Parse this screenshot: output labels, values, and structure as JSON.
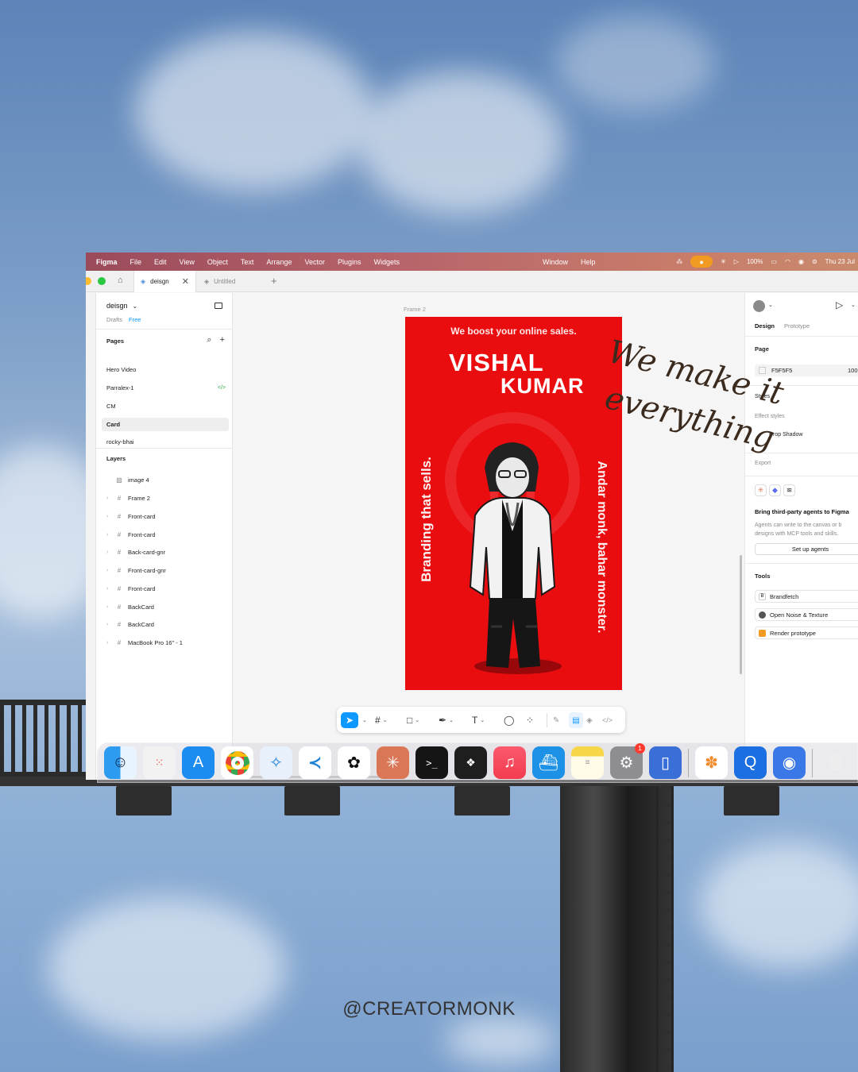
{
  "menubar": {
    "app": "Figma",
    "items": [
      "File",
      "Edit",
      "View",
      "Object",
      "Text",
      "Arrange",
      "Vector",
      "Plugins",
      "Widgets"
    ],
    "right_items": [
      "Window",
      "Help"
    ],
    "battery": "100%",
    "clock": "Thu 23 Jul"
  },
  "tabs": {
    "active": "deisgn",
    "inactive": "Untitled"
  },
  "file": {
    "name": "deisgn",
    "location": "Drafts",
    "plan": "Free"
  },
  "pages": {
    "title": "Pages",
    "items": [
      "Hero Video",
      "Parralex-1",
      "CM",
      "Card",
      "rocky-bhai"
    ],
    "selected": "Card"
  },
  "layers": {
    "title": "Layers",
    "items": [
      "image 4",
      "Frame 2",
      "Front-card",
      "Front-card",
      "Back-card-gnr",
      "Front-card-gnr",
      "Front-card",
      "BackCard",
      "BackCard",
      "MacBook Pro 16\" - 1"
    ]
  },
  "canvas": {
    "frame_label": "Frame 2",
    "card": {
      "tagline": "We boost your online sales.",
      "name_first": "VISHAL",
      "name_last": "KUMAR",
      "vertical_left": "Branding that sells.",
      "vertical_right": "Andar monk, bahar monster.",
      "accent": "#ea0d10"
    }
  },
  "right_panel": {
    "tabs": [
      "Design",
      "Prototype"
    ],
    "page_label": "Page",
    "page_color": "F5F5F5",
    "page_opacity": "100",
    "styles_label": "Styles",
    "effect_styles_label": "Effect styles",
    "drop_shadow": "Drop Shadow",
    "export_label": "Export",
    "agents_title": "Bring third-party agents to Figma",
    "agents_desc": "Agents can write to the canvas or b designs with MCP tools and skills.",
    "setup_button": "Set up agents",
    "tools_label": "Tools",
    "tools": [
      "Brandfetch",
      "Open Noise & Texture",
      "Render prototype"
    ]
  },
  "overlay_text": {
    "line1": "We make it",
    "line2": "everything"
  },
  "dock": {
    "badge_count": "1",
    "icons": [
      "finder-icon",
      "launchpad-icon",
      "app-store-icon",
      "chrome-icon",
      "safari-icon",
      "vscode-icon",
      "chatgpt-icon",
      "claude-icon",
      "terminal-icon",
      "figma-icon",
      "music-icon",
      "docker-icon",
      "notes-icon",
      "system-settings-icon",
      "simulator-icon",
      "photos-icon",
      "quicktime-icon",
      "preview-icon",
      "trash-icon"
    ]
  },
  "handle": "@CREATORMONK"
}
